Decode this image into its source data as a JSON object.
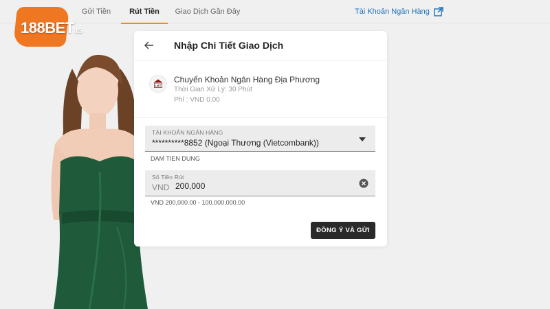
{
  "brand": {
    "logo_main": "188BET",
    "logo_tld": ".IS",
    "accent": "#f07722"
  },
  "nav": {
    "tabs": [
      {
        "label": "Gửi Tiền",
        "active": false
      },
      {
        "label": "Rút Tiền",
        "active": true
      },
      {
        "label": "Giao Dịch Gần Đây",
        "active": false
      }
    ],
    "bank_account_link": "Tài Khoản Ngân Hàng",
    "link_icon": "external-link-icon",
    "link_color": "#1a6fb8",
    "active_underline_color": "#f29100"
  },
  "card": {
    "title": "Nhập Chi Tiết Giao Dịch",
    "back_icon": "back-arrow-icon",
    "method": {
      "icon": "bank-icon",
      "icon_text": "LBT",
      "name": "Chuyển Khoản Ngân Hàng Địa Phương",
      "processing_time": "Thời Gian Xử Lý: 30 Phút",
      "fee": "Phí : VND 0.00"
    },
    "account_field": {
      "label": "TÀI KHOẢN NGÂN HÀNG",
      "value": "**********8852 (Ngoại Thương (Vietcombank))",
      "holder_name": "DAM TIEN DUNG"
    },
    "amount_field": {
      "label": "Số Tiền Rút",
      "currency": "VND",
      "value": "200,000",
      "range": "VND 200,000.00 - 100,000,000.00",
      "clear_icon": "clear-icon"
    },
    "submit_label": "ĐỒNG Ý VÀ GỬI",
    "submit_color": "#2a2a2a"
  }
}
